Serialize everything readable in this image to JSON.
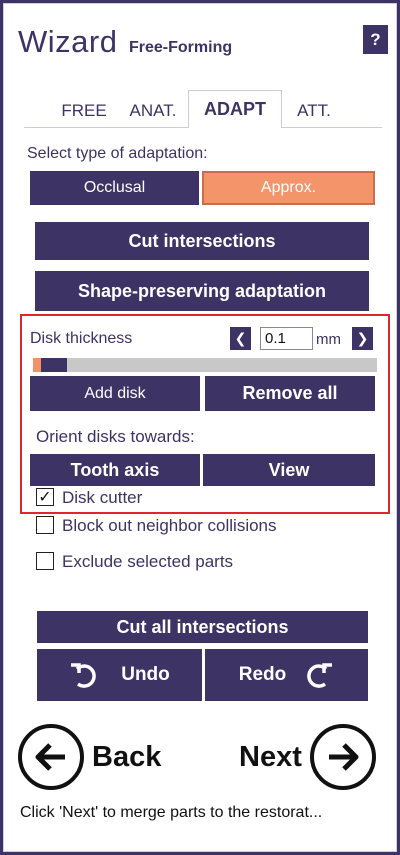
{
  "header": {
    "title": "Wizard",
    "subtitle": "Free-Forming",
    "help_label": "?"
  },
  "tabs": [
    {
      "label": "FREE",
      "active": false
    },
    {
      "label": "ANAT.",
      "active": false
    },
    {
      "label": "ADAPT",
      "active": true
    },
    {
      "label": "ATT.",
      "active": false
    }
  ],
  "adaptation": {
    "prompt": "Select type of adaptation:",
    "options": [
      "Occlusal",
      "Approx."
    ],
    "selected": "Approx."
  },
  "actions": {
    "cut_intersections": "Cut intersections",
    "shape_preserving": "Shape-preserving adaptation"
  },
  "disk": {
    "thickness_label": "Disk thickness",
    "thickness_value": "0.1",
    "unit": "mm",
    "slider_fraction": 0.1,
    "add_disk": "Add disk",
    "remove_all": "Remove all",
    "orient_label": "Orient disks towards:",
    "tooth_axis": "Tooth axis",
    "view": "View"
  },
  "options": {
    "disk_cutter": {
      "label": "Disk cutter",
      "checked": true
    },
    "block_out": {
      "label": "Block out neighbor collisions",
      "checked": false
    },
    "exclude_parts": {
      "label": "Exclude selected parts",
      "checked": false
    }
  },
  "bottom": {
    "cut_all": "Cut all intersections",
    "undo": "Undo",
    "redo": "Redo",
    "back": "Back",
    "next": "Next",
    "footer_text": "Click 'Next' to merge parts to the restorat..."
  },
  "colors": {
    "primary": "#3e3365",
    "accent": "#f3946b",
    "highlight_border": "#e0262c"
  }
}
